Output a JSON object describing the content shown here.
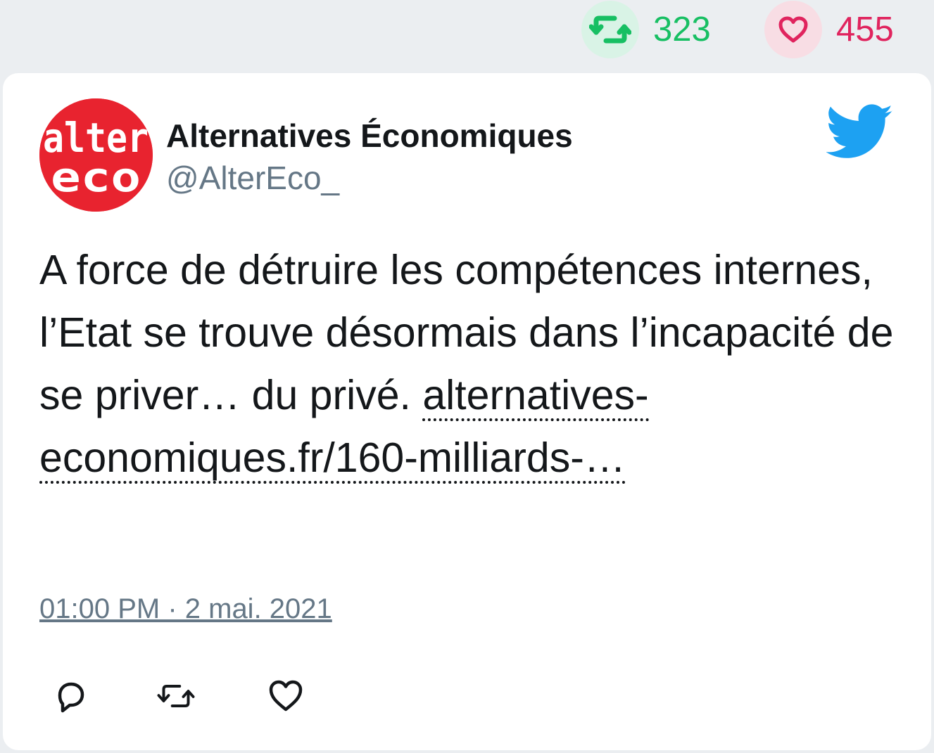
{
  "stats": {
    "retweet_count": "323",
    "like_count": "455",
    "retweet_icon": "retweet-icon",
    "like_icon": "heart-icon"
  },
  "tweet": {
    "author": {
      "name": "Alternatives Économiques",
      "handle": "@AlterEco_",
      "avatar_line1": "alter",
      "avatar_line2": "eco"
    },
    "text": "A force de détruire les compétences internes, l’Etat se trouve désormais dans l’incapacité de se priver… du privé.",
    "link": "alternatives-economiques.fr/160-milliards-…",
    "timestamp": "01:00 PM · 2 mai. 2021",
    "platform_icon": "twitter-bird-icon",
    "actions": [
      "reply-icon",
      "retweet-icon",
      "heart-icon"
    ]
  },
  "colors": {
    "page_background": "#ebeef1",
    "card_background": "#ffffff",
    "retweet_green": "#17bf63",
    "like_red": "#e0245e",
    "twitter_blue": "#1da1f2",
    "avatar_red": "#e8232f",
    "muted_text": "#657786",
    "text": "#14171a"
  }
}
